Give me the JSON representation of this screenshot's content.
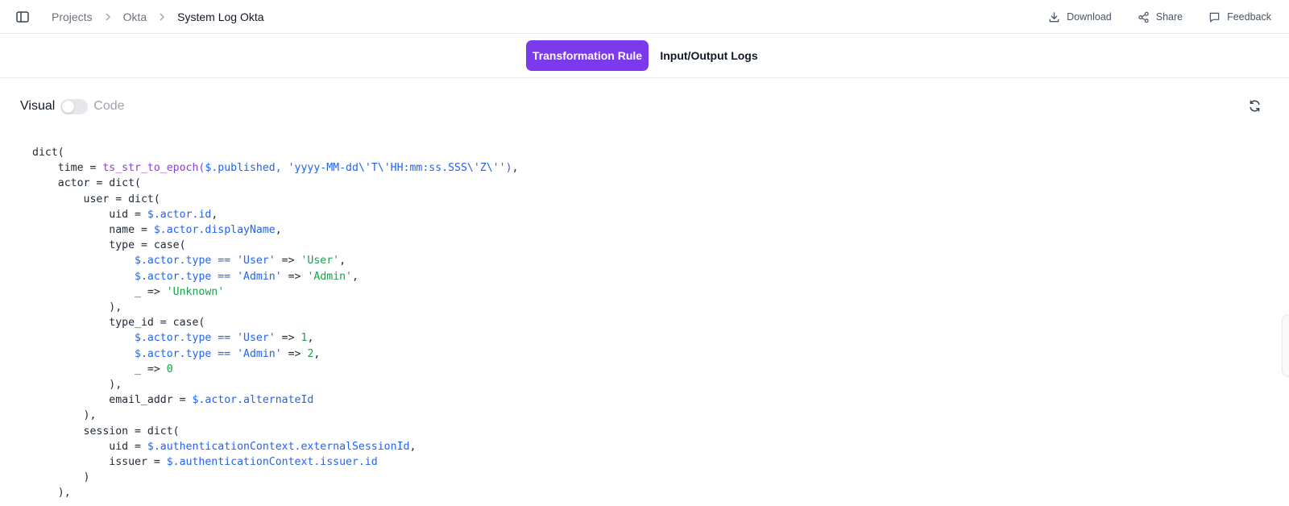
{
  "breadcrumb": [
    "Projects",
    "Okta",
    "System Log Okta"
  ],
  "actions": {
    "download": "Download",
    "share": "Share",
    "feedback": "Feedback"
  },
  "tabs": {
    "active": "Transformation Rule",
    "inactive": "Input/Output Logs"
  },
  "view_toggle": {
    "visual": "Visual",
    "code": "Code",
    "code_mode_on": false
  },
  "icons": [
    "sidebar-toggle-icon",
    "chevron-right-icon",
    "download-icon",
    "share-icon",
    "feedback-icon",
    "refresh-icon"
  ],
  "colors": {
    "accent": "#7c3aed",
    "code_function": "#8b3fd6",
    "code_reference": "#2563eb",
    "code_string": "#16a34a"
  },
  "code_lines": [
    [
      [
        "t",
        "dict("
      ]
    ],
    [
      [
        "t",
        "    time = "
      ],
      [
        "fn",
        "ts_str_to_epoch("
      ],
      [
        "ref",
        "$.published, 'yyyy-MM-dd\\'T\\'HH:mm:ss.SSS\\'Z\\''"
      ],
      [
        "fn",
        ")"
      ],
      [
        "t",
        ","
      ]
    ],
    [
      [
        "t",
        "    actor = dict("
      ]
    ],
    [
      [
        "t",
        "        user = dict("
      ]
    ],
    [
      [
        "t",
        "            uid = "
      ],
      [
        "ref",
        "$.actor.id"
      ],
      [
        "t",
        ","
      ]
    ],
    [
      [
        "t",
        "            name = "
      ],
      [
        "ref",
        "$.actor.displayName"
      ],
      [
        "t",
        ","
      ]
    ],
    [
      [
        "t",
        "            type = case("
      ]
    ],
    [
      [
        "t",
        "                "
      ],
      [
        "ref",
        "$.actor.type == 'User'"
      ],
      [
        "t",
        " => "
      ],
      [
        "str",
        "'User'"
      ],
      [
        "t",
        ","
      ]
    ],
    [
      [
        "t",
        "                "
      ],
      [
        "ref",
        "$.actor.type == 'Admin'"
      ],
      [
        "t",
        " => "
      ],
      [
        "str",
        "'Admin'"
      ],
      [
        "t",
        ","
      ]
    ],
    [
      [
        "t",
        "                _ => "
      ],
      [
        "str",
        "'Unknown'"
      ]
    ],
    [
      [
        "t",
        "            ),"
      ]
    ],
    [
      [
        "t",
        "            type_id = case("
      ]
    ],
    [
      [
        "t",
        "                "
      ],
      [
        "ref",
        "$.actor.type == 'User'"
      ],
      [
        "t",
        " => "
      ],
      [
        "num",
        "1"
      ],
      [
        "t",
        ","
      ]
    ],
    [
      [
        "t",
        "                "
      ],
      [
        "ref",
        "$.actor.type == 'Admin'"
      ],
      [
        "t",
        " => "
      ],
      [
        "num",
        "2"
      ],
      [
        "t",
        ","
      ]
    ],
    [
      [
        "t",
        "                _ => "
      ],
      [
        "num",
        "0"
      ]
    ],
    [
      [
        "t",
        "            ),"
      ]
    ],
    [
      [
        "t",
        "            email_addr = "
      ],
      [
        "ref",
        "$.actor.alternateId"
      ]
    ],
    [
      [
        "t",
        "        ),"
      ]
    ],
    [
      [
        "t",
        "        session = dict("
      ]
    ],
    [
      [
        "t",
        "            uid = "
      ],
      [
        "ref",
        "$.authenticationContext.externalSessionId"
      ],
      [
        "t",
        ","
      ]
    ],
    [
      [
        "t",
        "            issuer = "
      ],
      [
        "ref",
        "$.authenticationContext.issuer.id"
      ]
    ],
    [
      [
        "t",
        "        )"
      ]
    ],
    [
      [
        "t",
        "    ),"
      ]
    ]
  ]
}
